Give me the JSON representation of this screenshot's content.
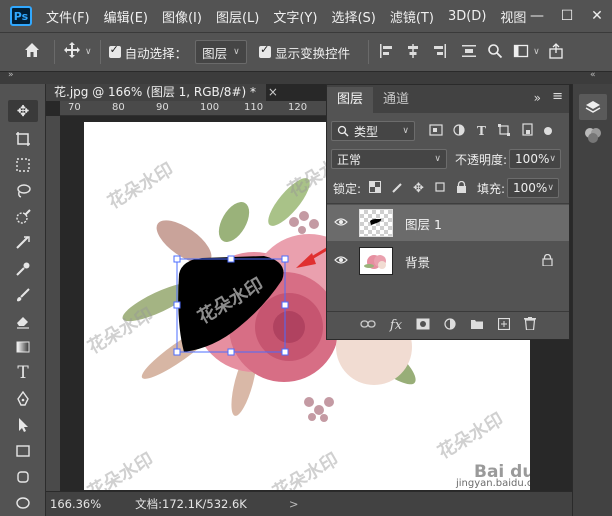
{
  "app": {
    "logo": "Ps"
  },
  "menu": [
    "文件(F)",
    "编辑(E)",
    "图像(I)",
    "图层(L)",
    "文字(Y)",
    "选择(S)",
    "滤镜(T)",
    "3D(D)",
    "视图"
  ],
  "window_controls": {
    "minimize": "—",
    "maximize": "☐",
    "close": "✕"
  },
  "options": {
    "auto_select_label": "自动选择：",
    "auto_select_value": "图层",
    "show_transform_label": "显示变换控件"
  },
  "document": {
    "tab_title": "花.jpg @ 166% (图层 1, RGB/8#) *",
    "tab_close": "×",
    "ruler_ticks": [
      "70",
      "80",
      "90",
      "100",
      "110",
      "120"
    ]
  },
  "status": {
    "zoom": "166.36%",
    "doc_info": "文档:172.1K/532.6K",
    "arrow": ">"
  },
  "watermark": {
    "text": "花朵水印",
    "site": "jingyan.baidu.com",
    "brand": "Bai du 经验"
  },
  "layers_panel": {
    "tabs": [
      "图层",
      "通道"
    ],
    "filter_label": "类型",
    "blend_mode": "正常",
    "opacity_label": "不透明度:",
    "opacity_value": "100%",
    "lock_label": "锁定:",
    "fill_label": "填充:",
    "fill_value": "100%",
    "layers": [
      {
        "name": "图层 1",
        "selected": true
      },
      {
        "name": "背景",
        "selected": false,
        "locked": true
      }
    ]
  },
  "colors": {
    "selection": "#6b6b6b",
    "accent": "#31a8ff",
    "arrow": "#e03030",
    "transform_box": "#4b6cff"
  }
}
